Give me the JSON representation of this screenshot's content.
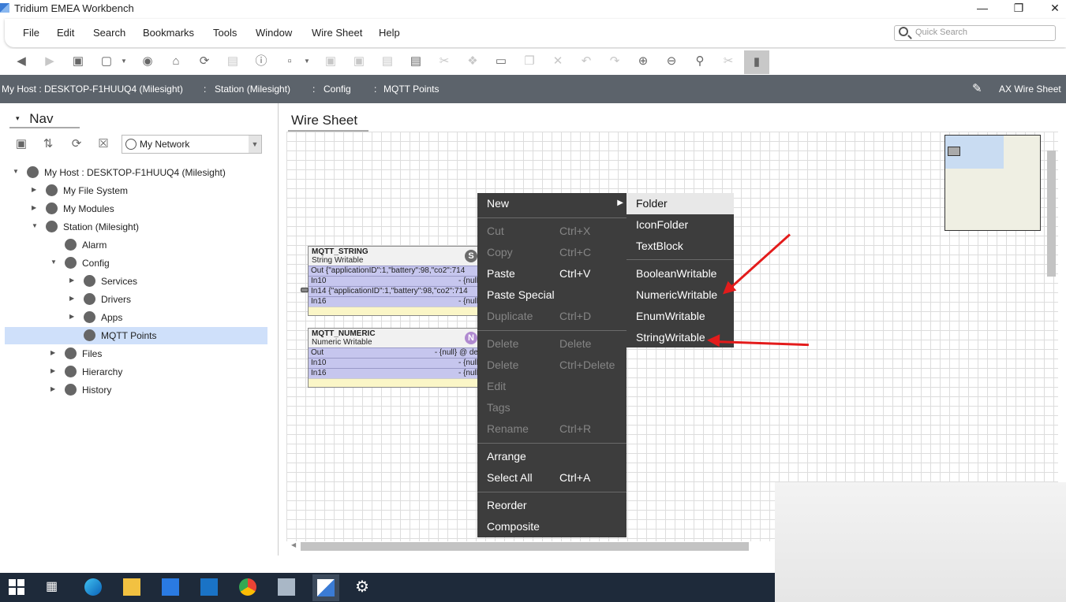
{
  "window": {
    "title": "Tridium EMEA Workbench",
    "min_icon": "minimize-icon",
    "max_icon": "maximize-icon",
    "close_icon": "close-icon"
  },
  "menu": [
    "File",
    "Edit",
    "Search",
    "Bookmarks",
    "Tools",
    "Window",
    "Wire Sheet",
    "Help"
  ],
  "quick_search": {
    "placeholder": "Quick Search",
    "icon": "search-icon"
  },
  "breadcrumb": {
    "items": [
      "My Host : DESKTOP-F1HUUQ4 (Milesight)",
      "Station (Milesight)",
      "Config",
      "MQTT Points"
    ],
    "view": "AX Wire Sheet"
  },
  "nav": {
    "tab": "Nav",
    "network_select": "My Network",
    "tree": [
      {
        "label": "My Host : DESKTOP-F1HUUQ4 (Milesight)",
        "icon": "host-icon"
      },
      {
        "label": "My File System",
        "icon": "disk-icon"
      },
      {
        "label": "My Modules",
        "icon": "modules-icon"
      },
      {
        "label": "Station (Milesight)",
        "icon": "station-icon"
      },
      {
        "label": "Alarm",
        "icon": "bell-icon"
      },
      {
        "label": "Config",
        "icon": "config-icon"
      },
      {
        "label": "Services",
        "icon": "services-icon"
      },
      {
        "label": "Drivers",
        "icon": "drivers-icon"
      },
      {
        "label": "Apps",
        "icon": "apps-icon"
      },
      {
        "label": "MQTT Points",
        "icon": "folder-icon"
      },
      {
        "label": "Files",
        "icon": "files-icon"
      },
      {
        "label": "Hierarchy",
        "icon": "hierarchy-icon"
      },
      {
        "label": "History",
        "icon": "history-icon"
      }
    ]
  },
  "sheet": {
    "tab": "Wire Sheet",
    "components": [
      {
        "name": "MQTT_STRING",
        "type": "String Writable",
        "badge": "S",
        "badge_color": "#6b6b6b",
        "slots": [
          {
            "name": "Out  {\"applicationID\":1,\"battery\":98,\"co2\":714",
            "value": ""
          },
          {
            "name": "In10",
            "value": "- {null"
          },
          {
            "name": "In14  {\"applicationID\":1,\"battery\":98,\"co2\":714",
            "value": ""
          },
          {
            "name": "In16",
            "value": "- {null"
          }
        ]
      },
      {
        "name": "MQTT_NUMERIC",
        "type": "Numeric Writable",
        "badge": "N",
        "badge_color": "#b08ad0",
        "slots": [
          {
            "name": "Out",
            "value": "- {null} @ de"
          },
          {
            "name": "In10",
            "value": "- {null"
          },
          {
            "name": "In16",
            "value": "- {null"
          }
        ]
      }
    ]
  },
  "context_menu": {
    "items": [
      {
        "label": "New",
        "shortcut": "",
        "disabled": false
      },
      {
        "label": "Cut",
        "shortcut": "Ctrl+X",
        "disabled": true
      },
      {
        "label": "Copy",
        "shortcut": "Ctrl+C",
        "disabled": true
      },
      {
        "label": "Paste",
        "shortcut": "Ctrl+V",
        "disabled": false
      },
      {
        "label": "Paste Special",
        "shortcut": "",
        "disabled": false
      },
      {
        "label": "Duplicate",
        "shortcut": "Ctrl+D",
        "disabled": true
      },
      {
        "label": "Delete",
        "shortcut": "Delete",
        "disabled": true
      },
      {
        "label": "Delete",
        "shortcut": "Ctrl+Delete",
        "disabled": true
      },
      {
        "label": "Edit",
        "shortcut": "",
        "disabled": true
      },
      {
        "label": "Tags",
        "shortcut": "",
        "disabled": true
      },
      {
        "label": "Rename",
        "shortcut": "Ctrl+R",
        "disabled": true
      },
      {
        "label": "Arrange",
        "shortcut": "",
        "disabled": false
      },
      {
        "label": "Select All",
        "shortcut": "Ctrl+A",
        "disabled": false
      },
      {
        "label": "Reorder",
        "shortcut": "",
        "disabled": false
      },
      {
        "label": "Composite",
        "shortcut": "",
        "disabled": false
      }
    ]
  },
  "submenu": {
    "items": [
      "Folder",
      "IconFolder",
      "TextBlock",
      "BooleanWritable",
      "NumericWritable",
      "EnumWritable",
      "StringWritable"
    ]
  },
  "accent": {
    "annotation_arrow": "#e31b1b",
    "selection": "#cfe0fa",
    "breadcrumb_bg": "#5c636b"
  }
}
